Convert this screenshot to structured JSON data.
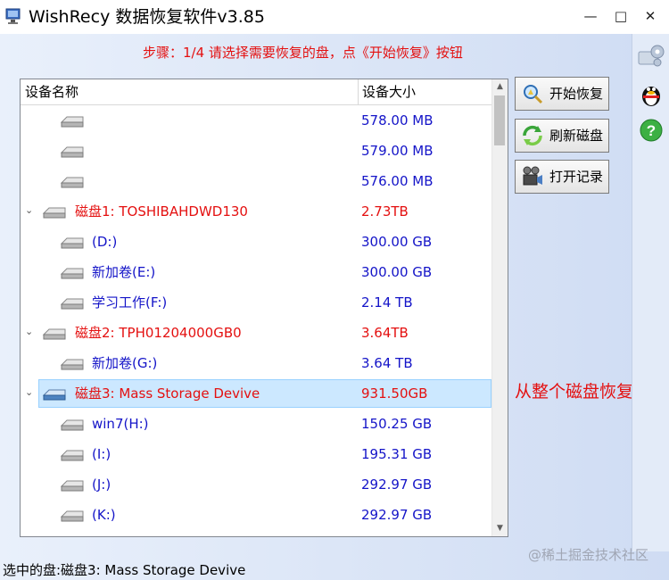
{
  "window": {
    "title": "WishRecy 数据恢复软件v3.85",
    "controls": [
      "—",
      "□",
      "✕"
    ]
  },
  "step_text": "步骤：1/4 请选择需要恢复的盘，点《开始恢复》按钮",
  "tree": {
    "columns": [
      "设备名称",
      "设备大小"
    ],
    "rows": [
      {
        "name": "",
        "size": "578.00 MB"
      },
      {
        "name": "",
        "size": "579.00 MB"
      },
      {
        "name": "",
        "size": "576.00 MB"
      },
      {
        "name": "磁盘1: TOSHIBAHDWD130",
        "size": "2.73TB"
      },
      {
        "name": "(D:)",
        "size": "300.00 GB"
      },
      {
        "name": "新加卷(E:)",
        "size": "300.00 GB"
      },
      {
        "name": "学习工作(F:)",
        "size": "2.14 TB"
      },
      {
        "name": "磁盘2: TPH01204000GB0",
        "size": "3.64TB"
      },
      {
        "name": "新加卷(G:)",
        "size": "3.64 TB"
      },
      {
        "name": "磁盘3: Mass Storage Devive",
        "size": "931.50GB"
      },
      {
        "name": "win7(H:)",
        "size": "150.25 GB"
      },
      {
        "name": "(I:)",
        "size": "195.31 GB"
      },
      {
        "name": "(J:)",
        "size": "292.97 GB"
      },
      {
        "name": "(K:)",
        "size": "292.97 GB"
      }
    ]
  },
  "buttons": {
    "start_recovery": "开始恢复",
    "refresh_disks": "刷新磁盘",
    "open_records": "打开记录"
  },
  "annotation": "从整个磁盘恢复",
  "watermark": "@稀土掘金技术社区",
  "status": "选中的盘:磁盘3: Mass Storage Devive",
  "colors": {
    "disk_text": "#e41010",
    "partition_text": "#1414c8",
    "selection": "#cce8ff"
  }
}
